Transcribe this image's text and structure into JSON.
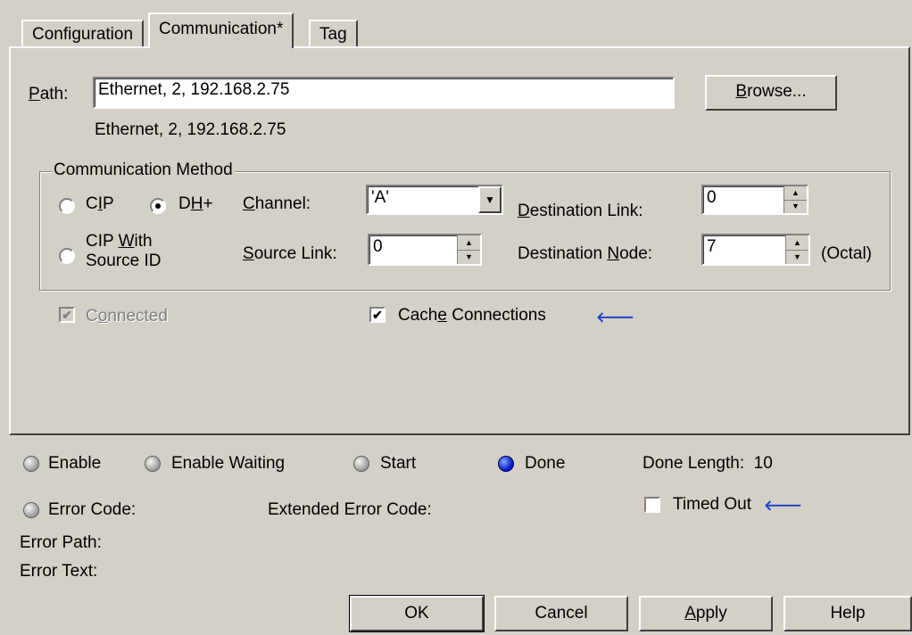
{
  "tabs": [
    {
      "label": "Configuration"
    },
    {
      "label": "Communication*"
    },
    {
      "label": "Tag"
    }
  ],
  "path": {
    "label": "Path:",
    "value": "Ethernet, 2, 192.168.2.75",
    "resolved": "Ethernet, 2, 192.168.2.75",
    "browse_label": "Browse..."
  },
  "comm_method": {
    "title": "Communication Method",
    "cip_label": "CIP",
    "dhplus_label": "DH+",
    "cip_source_line1": "CIP With",
    "cip_source_line2": "Source ID",
    "selected": "DH+",
    "channel_label": "Channel:",
    "channel_value": "'A'",
    "source_link_label": "Source Link:",
    "source_link_value": "0",
    "dest_link_label": "Destination Link:",
    "dest_link_value": "0",
    "dest_node_label": "Destination Node:",
    "dest_node_value": "7",
    "dest_node_unit": "(Octal)"
  },
  "options": {
    "connected_label": "Connected",
    "cache_label": "Cache Connections"
  },
  "status": {
    "enable": "Enable",
    "enable_waiting": "Enable Waiting",
    "start": "Start",
    "done": "Done",
    "done_length_label": "Done Length:",
    "done_length_value": "10",
    "error_code": "Error Code:",
    "extended_error_code": "Extended Error Code:",
    "timed_out": "Timed Out",
    "error_path": "Error Path:",
    "error_text": "Error Text:"
  },
  "buttons": {
    "ok": "OK",
    "cancel": "Cancel",
    "apply": "Apply",
    "help": "Help"
  },
  "icons": {
    "arrow": "left-arrow-icon"
  }
}
